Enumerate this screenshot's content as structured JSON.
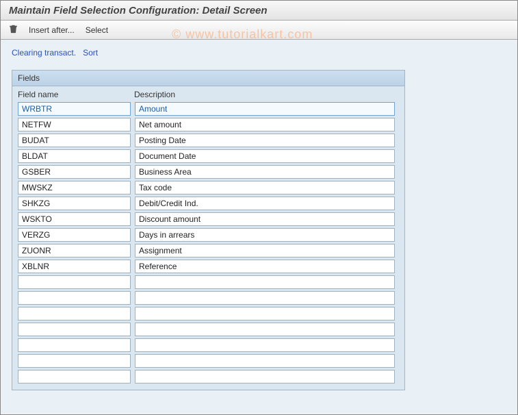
{
  "header": {
    "title": "Maintain Field Selection Configuration: Detail Screen"
  },
  "toolbar": {
    "delete_label": "",
    "insert_after_label": "Insert after...",
    "select_label": "Select"
  },
  "watermark": "© www.tutorialkart.com",
  "links": {
    "clearing": "Clearing transact.",
    "sort": "Sort"
  },
  "panel": {
    "title": "Fields",
    "col1": "Field name",
    "col2": "Description"
  },
  "rows": [
    {
      "name": "WRBTR",
      "desc": "Amount",
      "selected": true
    },
    {
      "name": "NETFW",
      "desc": "Net amount"
    },
    {
      "name": "BUDAT",
      "desc": "Posting Date"
    },
    {
      "name": "BLDAT",
      "desc": "Document Date"
    },
    {
      "name": "GSBER",
      "desc": "Business Area"
    },
    {
      "name": "MWSKZ",
      "desc": "Tax code"
    },
    {
      "name": "SHKZG",
      "desc": "Debit/Credit Ind."
    },
    {
      "name": "WSKTO",
      "desc": "Discount amount"
    },
    {
      "name": "VERZG",
      "desc": "Days in arrears"
    },
    {
      "name": "ZUONR",
      "desc": "Assignment"
    },
    {
      "name": "XBLNR",
      "desc": "Reference"
    },
    {
      "name": "",
      "desc": ""
    },
    {
      "name": "",
      "desc": ""
    },
    {
      "name": "",
      "desc": ""
    },
    {
      "name": "",
      "desc": ""
    },
    {
      "name": "",
      "desc": ""
    },
    {
      "name": "",
      "desc": ""
    },
    {
      "name": "",
      "desc": ""
    }
  ]
}
